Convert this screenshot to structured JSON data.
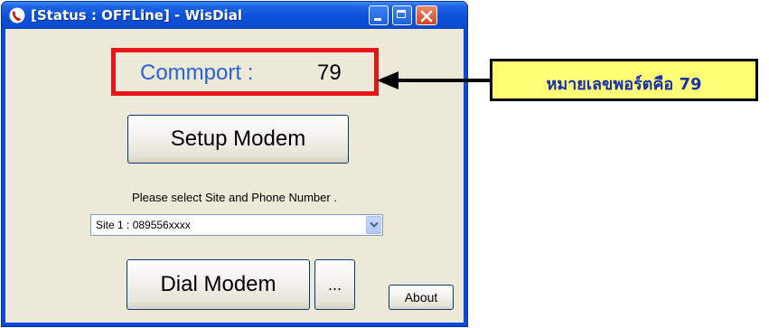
{
  "window": {
    "title": "[Status : OFFLine] - WisDial"
  },
  "commport": {
    "label": "Commport :",
    "value": "79"
  },
  "buttons": {
    "setup": "Setup Modem",
    "dial": "Dial Modem",
    "more": "...",
    "about": "About"
  },
  "site_select": {
    "prompt": "Please select Site and Phone Number .",
    "selected": "Site 1 : 089556xxxx"
  },
  "annotation": {
    "text": "หมายเลขพอร์ตคือ 79"
  },
  "icons": {
    "app": "phone-handset-icon",
    "minimize": "minimize-icon",
    "maximize": "maximize-icon",
    "close": "close-icon",
    "dropdown": "chevron-down-icon",
    "arrow": "arrow-left-icon"
  },
  "colors": {
    "titlebar": "#0a4ad8",
    "highlight_border": "#e8141b",
    "callout_bg": "#ffff75",
    "callout_text": "#1a2fb0",
    "commport_label": "#2a5fd8"
  }
}
